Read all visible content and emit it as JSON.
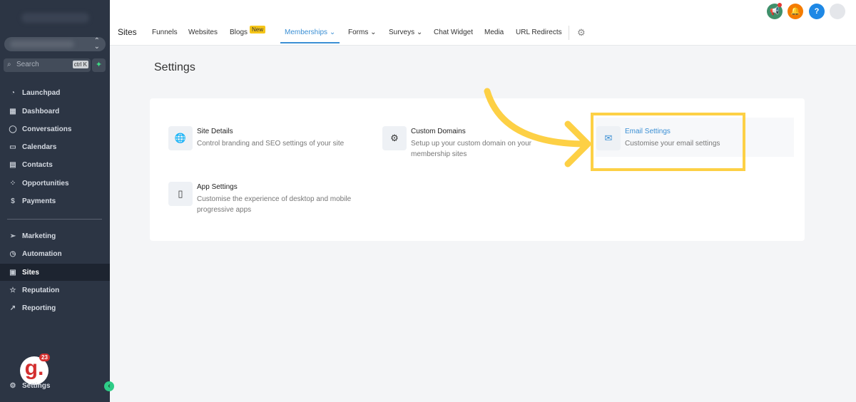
{
  "sidebar": {
    "search_placeholder": "Search",
    "search_shortcut": "ctrl K",
    "items": [
      {
        "label": "Launchpad",
        "icon": "launchpad-icon"
      },
      {
        "label": "Dashboard",
        "icon": "dashboard-icon"
      },
      {
        "label": "Conversations",
        "icon": "chat-icon"
      },
      {
        "label": "Calendars",
        "icon": "calendar-icon"
      },
      {
        "label": "Contacts",
        "icon": "contacts-icon"
      },
      {
        "label": "Opportunities",
        "icon": "opportunities-icon"
      },
      {
        "label": "Payments",
        "icon": "payments-icon"
      }
    ],
    "items2": [
      {
        "label": "Marketing",
        "icon": "send-icon"
      },
      {
        "label": "Automation",
        "icon": "automation-icon"
      },
      {
        "label": "Sites",
        "icon": "sites-icon",
        "active": true
      },
      {
        "label": "Reputation",
        "icon": "star-icon"
      },
      {
        "label": "Reporting",
        "icon": "chart-icon"
      }
    ],
    "settings_label": "Settings",
    "notification_count": "23",
    "logo_letter": "g."
  },
  "topbar": {
    "title": "Sites",
    "tabs": [
      "Funnels",
      "Websites",
      "Blogs",
      "Memberships",
      "Forms",
      "Surveys",
      "Chat Widget",
      "Media",
      "URL Redirects"
    ],
    "new_badge": "New",
    "help": "?"
  },
  "page": {
    "title": "Settings",
    "items": [
      {
        "title": "Site Details",
        "desc": "Control branding and SEO settings of your site"
      },
      {
        "title": "Custom Domains",
        "desc": "Setup up your custom domain on your membership sites"
      },
      {
        "title": "Email Settings",
        "desc": "Customise your email settings"
      },
      {
        "title": "App Settings",
        "desc": "Customise the experience of desktop and mobile progressive apps"
      }
    ]
  },
  "colors": {
    "accent": "#3b8fd4",
    "annotation": "#fdd045",
    "sidebar": "#2c3544"
  }
}
